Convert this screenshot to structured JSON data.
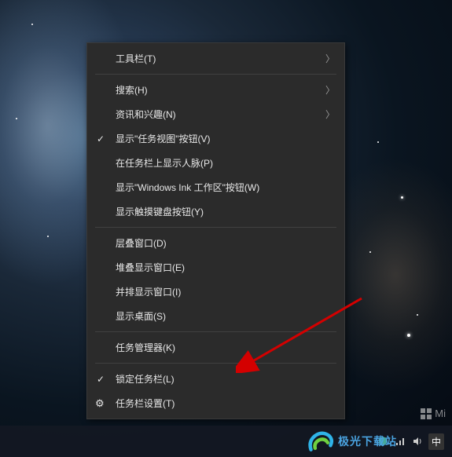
{
  "menu": {
    "toolbar": "工具栏(T)",
    "search": "搜索(H)",
    "news_interests": "资讯和兴趣(N)",
    "show_taskview_btn": "显示\"任务视图\"按钮(V)",
    "show_people": "在任务栏上显示人脉(P)",
    "show_ink": "显示\"Windows Ink 工作区\"按钮(W)",
    "show_touch_kb": "显示触摸键盘按钮(Y)",
    "cascade": "层叠窗口(D)",
    "stacked": "堆叠显示窗口(E)",
    "side_by_side": "并排显示窗口(I)",
    "show_desktop": "显示桌面(S)",
    "task_manager": "任务管理器(K)",
    "lock_taskbar": "锁定任务栏(L)",
    "taskbar_settings": "任务栏设置(T)"
  },
  "watermark": {
    "text": "Mi"
  },
  "logo": {
    "text": "极光下载站"
  },
  "tray": {
    "ime": "中"
  }
}
